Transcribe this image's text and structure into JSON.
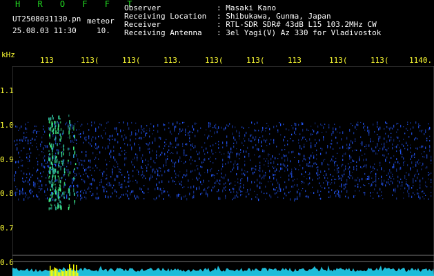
{
  "header": {
    "title": "H R O F F T",
    "filename": "UT2508031130.pn",
    "meteor_label": "meteor",
    "timestamp": "25.08.03 11:30",
    "seconds": "10."
  },
  "info": [
    {
      "key": "Observer",
      "sep": ":",
      "value": "Masaki Kano"
    },
    {
      "key": "Receiving Location",
      "sep": ":",
      "value": "Shibukawa, Gunma, Japan"
    },
    {
      "key": "Receiver",
      "sep": ":",
      "value": "RTL-SDR SDR# 43dB L15 103.2MHz CW"
    },
    {
      "key": "Receiving Antenna",
      "sep": ":",
      "value": "3el Yagi(V) Az 330 for Vladivostok"
    }
  ],
  "axis": {
    "unit": "kHz",
    "x_ticks": [
      "113",
      "113(",
      "113(",
      "113.",
      "113(",
      "113(",
      "113",
      "113(",
      "113(",
      "1140."
    ],
    "y_ticks": [
      "1.1",
      "1.0",
      "0.9",
      "0.8",
      "0.7",
      "0.6"
    ]
  },
  "colors": {
    "title": "#22dd22",
    "label": "#ffffff",
    "tick": "#ffff33",
    "signal": "#2244ff",
    "echo": "#44ff88",
    "baseline": "#22ddff",
    "burst": "#ffff00"
  }
}
